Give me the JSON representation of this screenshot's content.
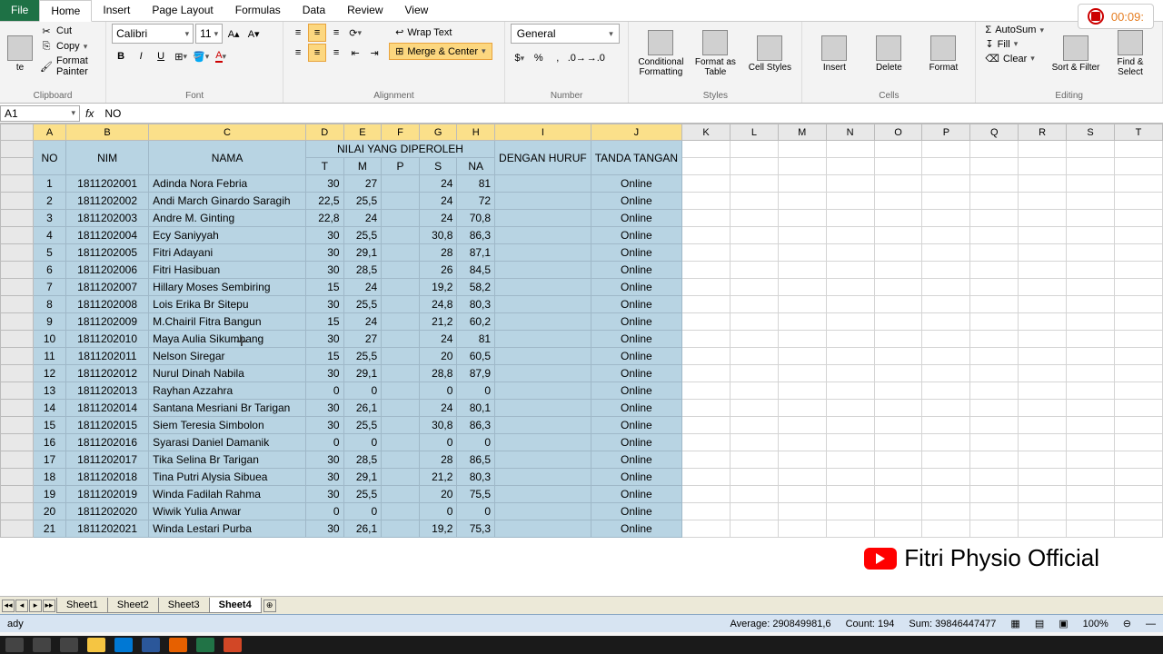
{
  "tabs": {
    "file": "File",
    "home": "Home",
    "insert": "Insert",
    "page_layout": "Page Layout",
    "formulas": "Formulas",
    "data": "Data",
    "review": "Review",
    "view": "View"
  },
  "recording": {
    "time": "00:09:"
  },
  "clipboard": {
    "cut": "Cut",
    "copy": "Copy",
    "paint": "Format Painter",
    "label": "Clipboard"
  },
  "font": {
    "name": "Calibri",
    "size": "11",
    "label": "Font"
  },
  "alignment": {
    "wrap": "Wrap Text",
    "merge": "Merge & Center",
    "label": "Alignment"
  },
  "number": {
    "format": "General",
    "label": "Number"
  },
  "styles": {
    "cond": "Conditional Formatting",
    "table": "Format as Table",
    "cell": "Cell Styles",
    "label": "Styles"
  },
  "cells": {
    "insert": "Insert",
    "delete": "Delete",
    "format": "Format",
    "label": "Cells"
  },
  "editing": {
    "sum": "AutoSum",
    "fill": "Fill",
    "clear": "Clear",
    "sort": "Sort & Filter",
    "find": "Find & Select",
    "label": "Editing"
  },
  "name_box": "A1",
  "formula": "NO",
  "col_headers": [
    "A",
    "B",
    "C",
    "D",
    "E",
    "F",
    "G",
    "H",
    "I",
    "J",
    "K",
    "L",
    "M",
    "N",
    "O",
    "P",
    "Q",
    "R",
    "S",
    "T"
  ],
  "headers": {
    "no": "NO",
    "nim": "NIM",
    "nama": "NAMA",
    "nilai": "NILAI YANG DIPEROLEH",
    "huruf": "DENGAN HURUF",
    "tanda": "TANDA TANGAN",
    "t": "T",
    "m": "M",
    "p": "P",
    "s": "S",
    "na": "NA"
  },
  "rows": [
    {
      "n": "1",
      "nim": "1811202001",
      "nama": "Adinda Nora Febria",
      "t": "30",
      "m": "27",
      "p": "",
      "s": "24",
      "na": "81",
      "tt": "Online"
    },
    {
      "n": "2",
      "nim": "1811202002",
      "nama": "Andi March Ginardo Saragih",
      "t": "22,5",
      "m": "25,5",
      "p": "",
      "s": "24",
      "na": "72",
      "tt": "Online"
    },
    {
      "n": "3",
      "nim": "1811202003",
      "nama": "Andre M. Ginting",
      "t": "22,8",
      "m": "24",
      "p": "",
      "s": "24",
      "na": "70,8",
      "tt": "Online"
    },
    {
      "n": "4",
      "nim": "1811202004",
      "nama": "Ecy Saniyyah",
      "t": "30",
      "m": "25,5",
      "p": "",
      "s": "30,8",
      "na": "86,3",
      "tt": "Online"
    },
    {
      "n": "5",
      "nim": "1811202005",
      "nama": "Fitri Adayani",
      "t": "30",
      "m": "29,1",
      "p": "",
      "s": "28",
      "na": "87,1",
      "tt": "Online"
    },
    {
      "n": "6",
      "nim": "1811202006",
      "nama": "Fitri Hasibuan",
      "t": "30",
      "m": "28,5",
      "p": "",
      "s": "26",
      "na": "84,5",
      "tt": "Online"
    },
    {
      "n": "7",
      "nim": "1811202007",
      "nama": "Hillary Moses Sembiring",
      "t": "15",
      "m": "24",
      "p": "",
      "s": "19,2",
      "na": "58,2",
      "tt": "Online"
    },
    {
      "n": "8",
      "nim": "1811202008",
      "nama": "Lois Erika Br Sitepu",
      "t": "30",
      "m": "25,5",
      "p": "",
      "s": "24,8",
      "na": "80,3",
      "tt": "Online"
    },
    {
      "n": "9",
      "nim": "1811202009",
      "nama": "M.Chairil Fitra Bangun",
      "t": "15",
      "m": "24",
      "p": "",
      "s": "21,2",
      "na": "60,2",
      "tt": "Online"
    },
    {
      "n": "10",
      "nim": "1811202010",
      "nama": "Maya Aulia Sikumbang",
      "t": "30",
      "m": "27",
      "p": "",
      "s": "24",
      "na": "81",
      "tt": "Online"
    },
    {
      "n": "11",
      "nim": "1811202011",
      "nama": "Nelson Siregar",
      "t": "15",
      "m": "25,5",
      "p": "",
      "s": "20",
      "na": "60,5",
      "tt": "Online"
    },
    {
      "n": "12",
      "nim": "1811202012",
      "nama": "Nurul Dinah Nabila",
      "t": "30",
      "m": "29,1",
      "p": "",
      "s": "28,8",
      "na": "87,9",
      "tt": "Online"
    },
    {
      "n": "13",
      "nim": "1811202013",
      "nama": "Rayhan Azzahra",
      "t": "0",
      "m": "0",
      "p": "",
      "s": "0",
      "na": "0",
      "tt": "Online"
    },
    {
      "n": "14",
      "nim": "1811202014",
      "nama": "Santana Mesriani Br Tarigan",
      "t": "30",
      "m": "26,1",
      "p": "",
      "s": "24",
      "na": "80,1",
      "tt": "Online"
    },
    {
      "n": "15",
      "nim": "1811202015",
      "nama": "Siem Teresia Simbolon",
      "t": "30",
      "m": "25,5",
      "p": "",
      "s": "30,8",
      "na": "86,3",
      "tt": "Online"
    },
    {
      "n": "16",
      "nim": "1811202016",
      "nama": "Syarasi Daniel Damanik",
      "t": "0",
      "m": "0",
      "p": "",
      "s": "0",
      "na": "0",
      "tt": "Online"
    },
    {
      "n": "17",
      "nim": "1811202017",
      "nama": "Tika Selina Br Tarigan",
      "t": "30",
      "m": "28,5",
      "p": "",
      "s": "28",
      "na": "86,5",
      "tt": "Online"
    },
    {
      "n": "18",
      "nim": "1811202018",
      "nama": "Tina Putri Alysia Sibuea",
      "t": "30",
      "m": "29,1",
      "p": "",
      "s": "21,2",
      "na": "80,3",
      "tt": "Online"
    },
    {
      "n": "19",
      "nim": "1811202019",
      "nama": "Winda Fadilah Rahma",
      "t": "30",
      "m": "25,5",
      "p": "",
      "s": "20",
      "na": "75,5",
      "tt": "Online"
    },
    {
      "n": "20",
      "nim": "1811202020",
      "nama": "Wiwik Yulia Anwar",
      "t": "0",
      "m": "0",
      "p": "",
      "s": "0",
      "na": "0",
      "tt": "Online"
    },
    {
      "n": "21",
      "nim": "1811202021",
      "nama": "Winda Lestari Purba",
      "t": "30",
      "m": "26,1",
      "p": "",
      "s": "19,2",
      "na": "75,3",
      "tt": "Online"
    }
  ],
  "sheets": [
    "Sheet1",
    "Sheet2",
    "Sheet3",
    "Sheet4"
  ],
  "active_sheet": 3,
  "status": {
    "mode": "ady",
    "avg": "Average: 290849981,6",
    "count": "Count: 194",
    "sum": "Sum: 39846447477",
    "zoom": "100%"
  },
  "watermark": "Fitri Physio Official"
}
